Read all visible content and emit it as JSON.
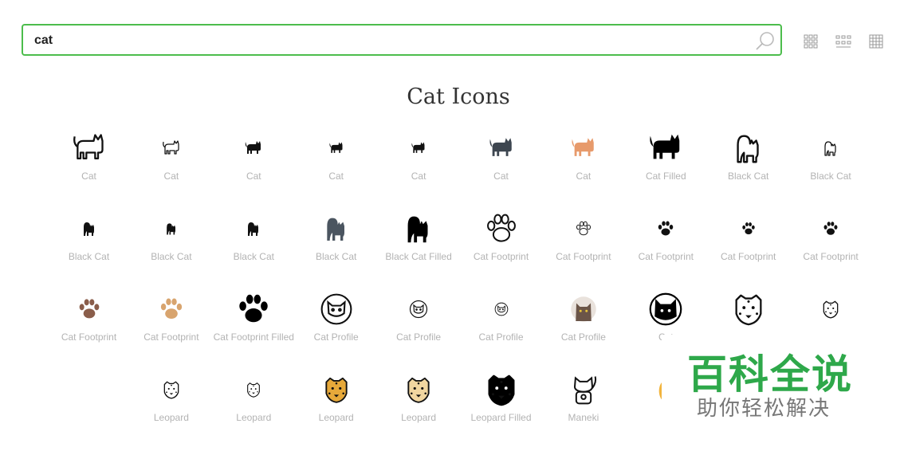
{
  "search": {
    "value": "cat"
  },
  "page_title": "Cat Icons",
  "icons": [
    {
      "label": "Cat",
      "style": "outline",
      "color": "#111",
      "size": 44
    },
    {
      "label": "Cat",
      "style": "outline",
      "color": "#111",
      "size": 24
    },
    {
      "label": "Cat",
      "style": "filled",
      "color": "#111",
      "size": 24
    },
    {
      "label": "Cat",
      "style": "filled",
      "color": "#111",
      "size": 20
    },
    {
      "label": "Cat",
      "style": "filled",
      "color": "#111",
      "size": 20
    },
    {
      "label": "Cat",
      "style": "filled",
      "color": "#3d4650",
      "size": 34
    },
    {
      "label": "Cat",
      "style": "filled",
      "color": "#e79a6b",
      "size": 34
    },
    {
      "label": "Cat Filled",
      "style": "filled",
      "color": "#000",
      "size": 46
    },
    {
      "label": "Black Cat",
      "style": "arched-outline",
      "color": "#111",
      "size": 46
    },
    {
      "label": "Black Cat",
      "style": "arched-outline",
      "color": "#111",
      "size": 24
    },
    {
      "label": "Black Cat",
      "style": "arched",
      "color": "#111",
      "size": 24
    },
    {
      "label": "Black Cat",
      "style": "arched",
      "color": "#111",
      "size": 20
    },
    {
      "label": "Black Cat",
      "style": "arched",
      "color": "#111",
      "size": 24
    },
    {
      "label": "Black Cat",
      "style": "arched",
      "color": "#4b5560",
      "size": 40
    },
    {
      "label": "Black Cat Filled",
      "style": "arched",
      "color": "#000",
      "size": 46
    },
    {
      "label": "Cat Footprint",
      "style": "paw-outline",
      "color": "#111",
      "size": 44
    },
    {
      "label": "Cat Footprint",
      "style": "paw-outline",
      "color": "#111",
      "size": 22
    },
    {
      "label": "Cat Footprint",
      "style": "paw",
      "color": "#111",
      "size": 24
    },
    {
      "label": "Cat Footprint",
      "style": "paw",
      "color": "#111",
      "size": 20
    },
    {
      "label": "Cat Footprint",
      "style": "paw",
      "color": "#111",
      "size": 22
    },
    {
      "label": "Cat Footprint",
      "style": "paw",
      "color": "#8a5d4a",
      "size": 32
    },
    {
      "label": "Cat Footprint",
      "style": "paw",
      "color": "#d8a46e",
      "size": 34
    },
    {
      "label": "Cat Footprint Filled",
      "style": "paw",
      "color": "#000",
      "size": 46
    },
    {
      "label": "Cat Profile",
      "style": "profile-outline",
      "color": "#111",
      "size": 42
    },
    {
      "label": "Cat Profile",
      "style": "profile-outline",
      "color": "#111",
      "size": 24
    },
    {
      "label": "Cat Profile",
      "style": "profile-outline",
      "color": "#111",
      "size": 18
    },
    {
      "label": "Cat Profile",
      "style": "profile-color",
      "color": "#6b5548",
      "size": 36
    },
    {
      "label": "Cat",
      "style": "profile-filled",
      "color": "#000",
      "size": 44
    },
    {
      "label": "",
      "style": "leopard-outline",
      "color": "#111",
      "size": 46
    },
    {
      "label": "",
      "style": "leopard-outline",
      "color": "#111",
      "size": 26
    },
    {
      "label": "Leopard",
      "style": "leopard-outline",
      "color": "#111",
      "size": 26
    },
    {
      "label": "Leopard",
      "style": "leopard-outline",
      "color": "#111",
      "size": 22
    },
    {
      "label": "Leopard",
      "style": "leopard-color",
      "color": "#e7a93a",
      "size": 38
    },
    {
      "label": "Leopard",
      "style": "leopard-color",
      "color": "#f1d6a0",
      "size": 38
    },
    {
      "label": "Leopard Filled",
      "style": "leopard-filled",
      "color": "#000",
      "size": 46
    },
    {
      "label": "Maneki",
      "style": "maneki",
      "color": "#111",
      "size": 44
    },
    {
      "label": "M",
      "style": "partial",
      "color": "#f2b43d",
      "size": 40
    }
  ],
  "watermark": {
    "main": "百科全说",
    "sub": "助你轻松解决"
  }
}
